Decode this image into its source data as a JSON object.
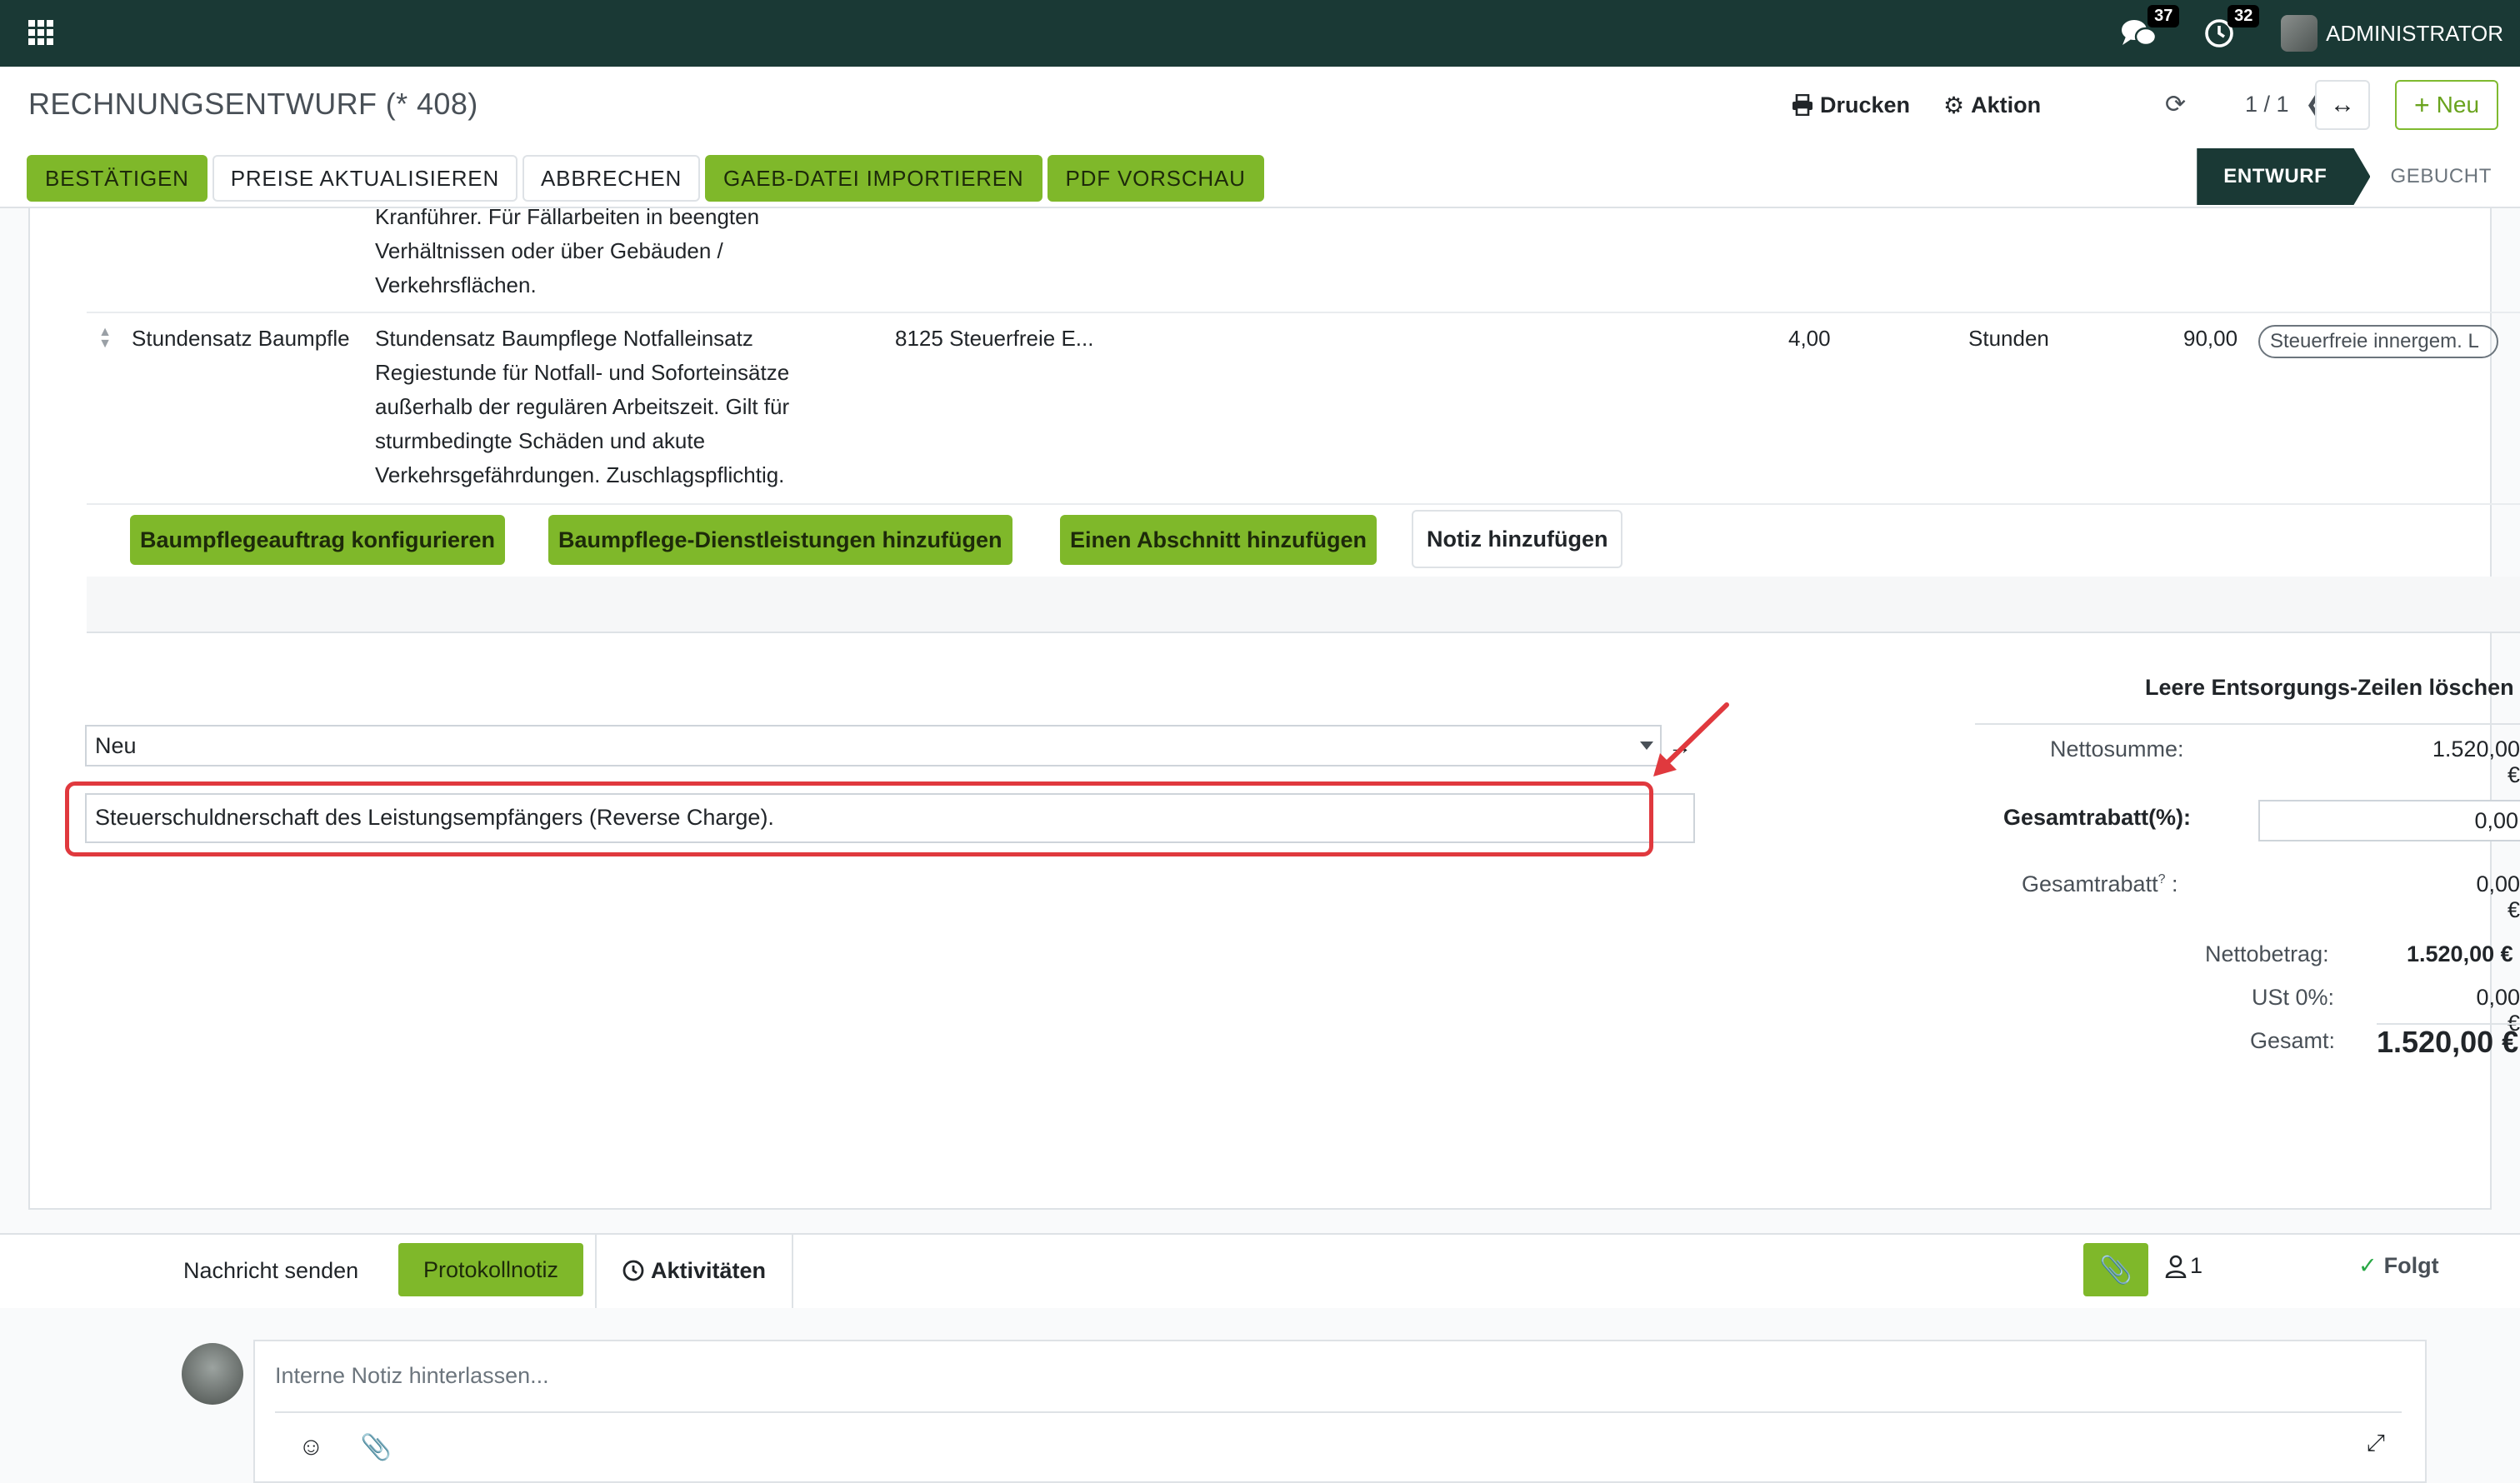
{
  "navbar": {
    "messages_count": "37",
    "activities_count": "32",
    "user_name": "ADMINISTRATOR"
  },
  "control": {
    "breadcrumb": "RECHNUNGSENTWURF (* 408)",
    "print_label": "Drucken",
    "action_label": "Aktion",
    "pager": "1 / 1",
    "new_label": "Neu",
    "header_buttons": {
      "confirm": "BESTÄTIGEN",
      "update_prices": "PREISE AKTUALISIEREN",
      "cancel": "ABBRECHEN",
      "gaeb_import": "GAEB-DATEI IMPORTIEREN",
      "pdf_preview": "PDF VORSCHAU"
    },
    "status": {
      "draft": "ENTWURF",
      "posted": "GEBUCHT"
    }
  },
  "lines": {
    "previous_description": [
      "Kranführer. Für Fällarbeiten in beengten",
      "Verhältnissen oder über Gebäuden /",
      "Verkehrsflächen."
    ],
    "row": {
      "product": "Stundensatz Baumpfle",
      "description": [
        "Stundensatz Baumpflege Notfalleinsatz",
        "Regiestunde für Notfall- und Soforteinsätze",
        "außerhalb der regulären Arbeitszeit. Gilt für",
        "sturmbedingte Schäden und akute",
        "Verkehrsgefährdungen. Zuschlagspflichtig."
      ],
      "account": "8125 Steuerfreie E...",
      "quantity": "4,00",
      "uom": "Stunden",
      "price": "90,00",
      "tax": "Steuerfreie innergem. L"
    },
    "add_buttons": {
      "configure": "Baumpflegeauftrag konfigurieren",
      "services": "Baumpflege-Dienstleistungen hinzufügen",
      "section": "Einen Abschnitt hinzufügen",
      "note": "Notiz hinzufügen"
    }
  },
  "notes": {
    "select_value": "Neu",
    "text_value": "Steuerschuldnerschaft des Leistungsempfängers (Reverse Charge)."
  },
  "totals": {
    "cleanup_label": "Leere Entsorgungs-Zeilen löschen",
    "net_sum_label": "Nettosumme:",
    "net_sum_value": "1.520,00 €",
    "total_discount_pct_label": "Gesamtrabatt(%):",
    "total_discount_pct_value": "0,00",
    "total_discount_label": "Gesamtrabatt",
    "total_discount_help": "?",
    "total_discount_colon": ":",
    "total_discount_value": "0,00 €",
    "net_amount_label": "Nettobetrag:",
    "net_amount_value": "1.520,00 €",
    "tax_label": "USt 0%:",
    "tax_value": "0,00 €",
    "total_label": "Gesamt:",
    "total_value": "1.520,00 €"
  },
  "chatter": {
    "send_message": "Nachricht senden",
    "log_note": "Protokollnotiz",
    "activities": "Aktivitäten",
    "followers_count": "1",
    "following": "Folgt",
    "composer_placeholder": "Interne Notiz hinterlassen..."
  },
  "colors": {
    "navbar": "#1a3935",
    "accent_green": "#7fb82a",
    "highlight_red": "#e0393e"
  }
}
